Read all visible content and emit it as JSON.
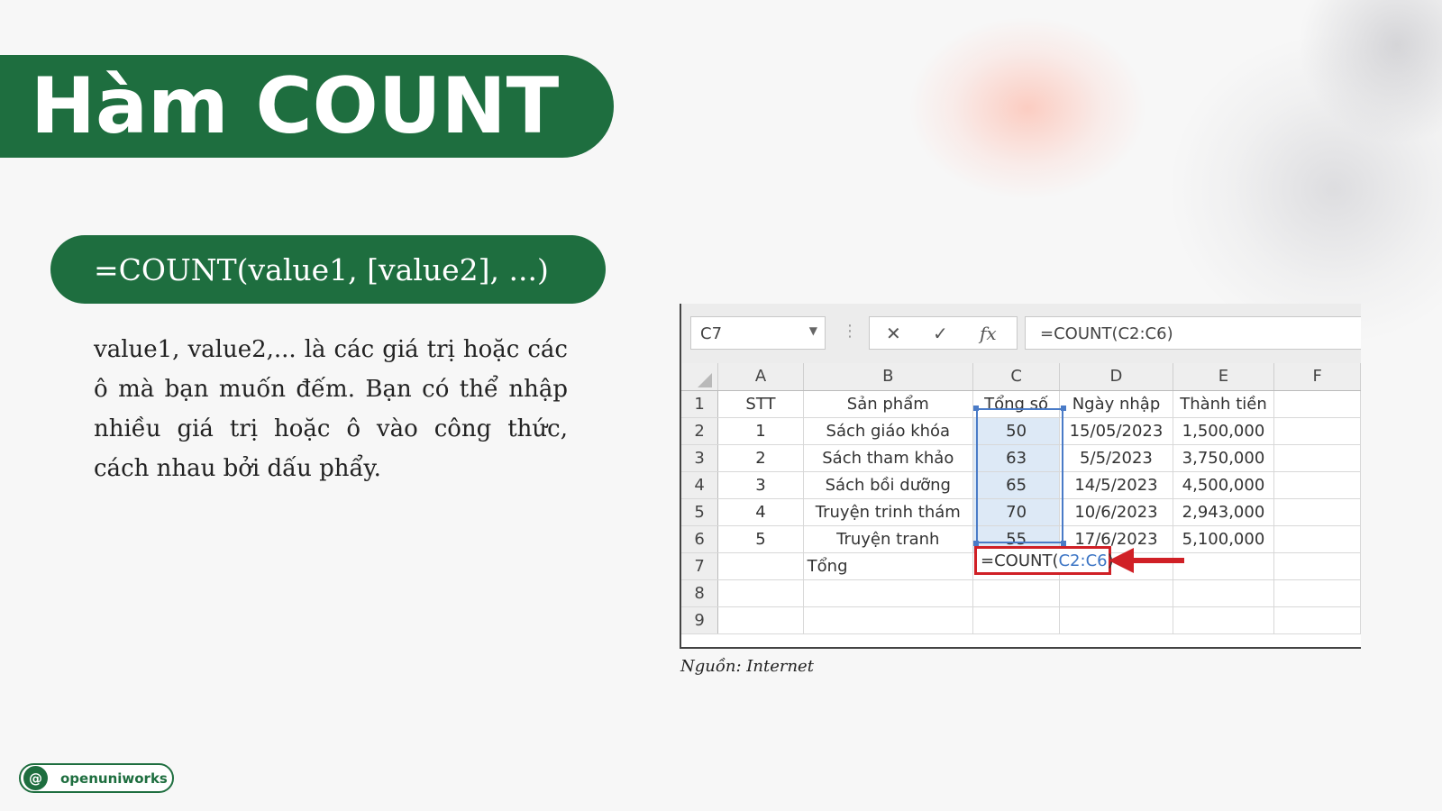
{
  "title": "Hàm COUNT",
  "syntax": "=COUNT(value1, [value2], ...)",
  "description": "value1, value2,... là các giá trị hoặc các ô mà bạn muốn đếm. Bạn có thể nhập nhiều giá trị hoặc ô vào công thức, cách nhau bởi dấu phẩy.",
  "excel": {
    "name_box": "C7",
    "formula": "=COUNT(C2:C6)",
    "buttons": {
      "cancel": "✕",
      "enter": "✓",
      "fx": "fx"
    },
    "column_headers": [
      "A",
      "B",
      "C",
      "D",
      "E",
      "F"
    ],
    "row_headers": [
      "1",
      "2",
      "3",
      "4",
      "5",
      "6",
      "7",
      "8",
      "9"
    ],
    "rows": [
      [
        "STT",
        "Sản phẩm",
        "Tổng số",
        "Ngày nhập",
        "Thành tiền",
        ""
      ],
      [
        "1",
        "Sách giáo khóa",
        "50",
        "15/05/2023",
        "1,500,000",
        ""
      ],
      [
        "2",
        "Sách tham khảo",
        "63",
        "5/5/2023",
        "3,750,000",
        ""
      ],
      [
        "3",
        "Sách bồi dưỡng",
        "65",
        "14/5/2023",
        "4,500,000",
        ""
      ],
      [
        "4",
        "Truyện trinh thám",
        "70",
        "10/6/2023",
        "2,943,000",
        ""
      ],
      [
        "5",
        "Truyện tranh",
        "55",
        "17/6/2023",
        "5,100,000",
        ""
      ],
      [
        "",
        "Tổng",
        "",
        "",
        "",
        ""
      ],
      [
        "",
        "",
        "",
        "",
        "",
        ""
      ],
      [
        "",
        "",
        "",
        "",
        "",
        ""
      ]
    ],
    "active_cell": {
      "prefix": "=COUNT(",
      "reference": "C2:C6",
      "suffix": ")"
    },
    "highlight_color": "#d02026",
    "selection_color": "#4a7bc7"
  },
  "caption": "Nguồn: Internet",
  "brand": {
    "icon": "@",
    "name": "openuniworks",
    "color": "#1e6e3f"
  },
  "theme": {
    "accent": "#1e6e3f",
    "background": "#f7f7f7"
  }
}
